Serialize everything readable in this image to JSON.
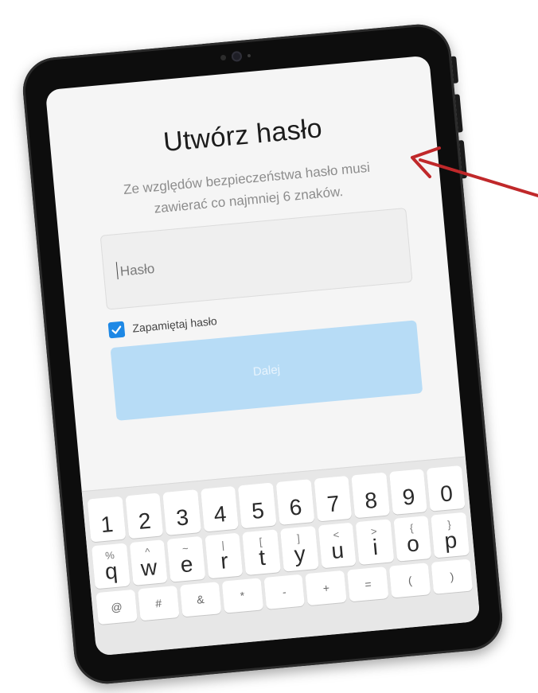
{
  "screen": {
    "title": "Utwórz hasło",
    "subtitle_line1": "Ze względów bezpieczeństwa hasło musi",
    "subtitle_line2": "zawierać co najmniej 6 znaków.",
    "password_input": {
      "placeholder": "Hasło",
      "value": ""
    },
    "remember_checkbox": {
      "label": "Zapamiętaj hasło",
      "checked": true
    },
    "next_button_label": "Dalej"
  },
  "keyboard": {
    "number_row": [
      "1",
      "2",
      "3",
      "4",
      "5",
      "6",
      "7",
      "8",
      "9",
      "0"
    ],
    "letter_row": [
      {
        "key": "q",
        "sup": "%"
      },
      {
        "key": "w",
        "sup": "^"
      },
      {
        "key": "e",
        "sup": "~"
      },
      {
        "key": "r",
        "sup": "|"
      },
      {
        "key": "t",
        "sup": "["
      },
      {
        "key": "y",
        "sup": "]"
      },
      {
        "key": "u",
        "sup": "<"
      },
      {
        "key": "i",
        "sup": ">"
      },
      {
        "key": "o",
        "sup": "{"
      },
      {
        "key": "p",
        "sup": "}"
      }
    ],
    "bottom_row": [
      "@",
      "#",
      "&",
      "*",
      "-",
      "+",
      "=",
      "(",
      ")"
    ]
  },
  "colors": {
    "accent": "#1e88e5",
    "button_disabled": "#b7dcf6",
    "arrow": "#c0282a"
  }
}
